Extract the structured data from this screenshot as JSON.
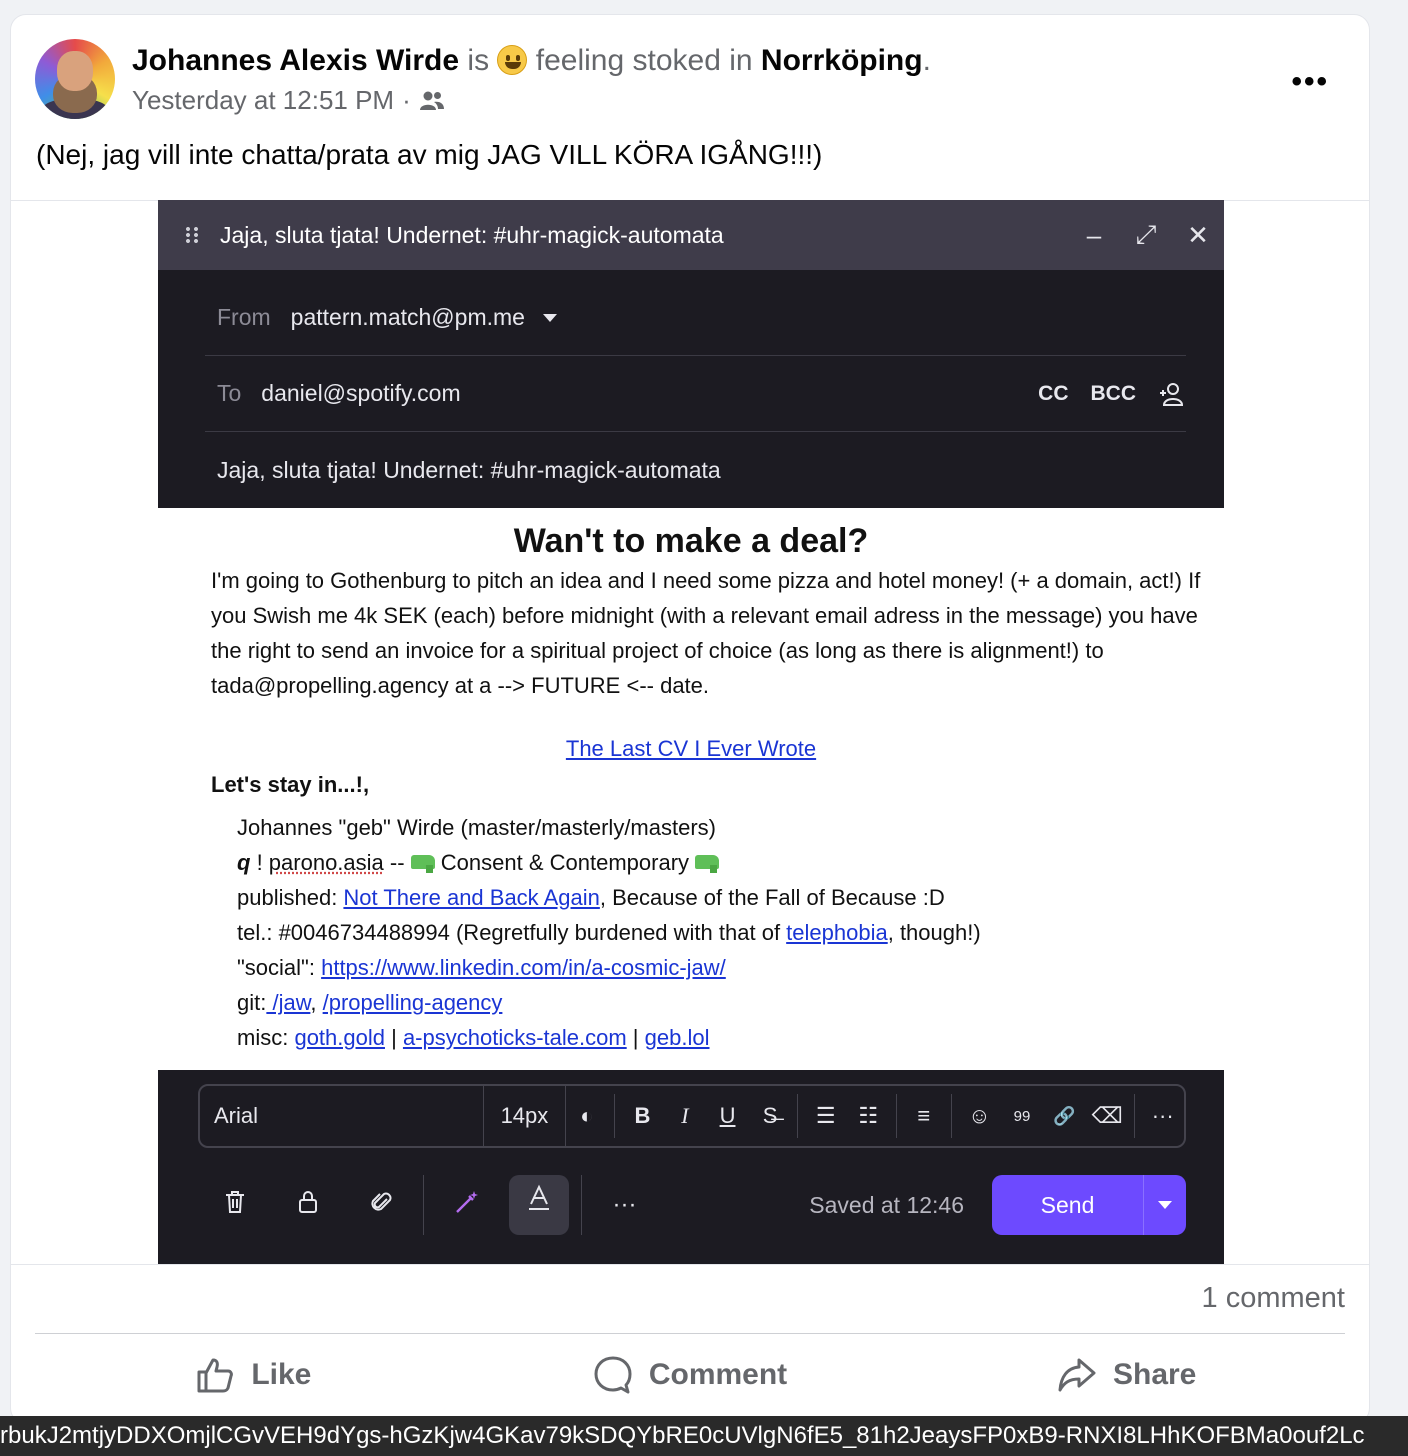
{
  "post": {
    "author": "Johannes Alexis Wirde",
    "is_word": "is",
    "feeling": "feeling stoked in",
    "place": "Norrköping",
    "period": ".",
    "timestamp": "Yesterday at 12:51 PM",
    "dot": "·",
    "audience_icon": "friends-icon",
    "more": "•••",
    "text": "(Nej, jag vill inte chatta/prata av mig JAG VILL KÖRA IGÅNG!!!)"
  },
  "shot": {
    "window_title": "Jaja, sluta tjata! Undernet: #uhr-magick-automata",
    "controls": [
      "–",
      "⤢",
      "✕"
    ],
    "from_label": "From",
    "from_value": "pattern.match@pm.me",
    "to_label": "To",
    "to_value": "daniel@spotify.com",
    "cc": "CC",
    "bcc": "BCC",
    "subject": "Jaja, sluta tjata! Undernet: #uhr-magick-automata",
    "body_title": "Wan't to make a deal?",
    "body_text": "I'm going to Gothenburg to pitch an idea and I need some pizza and hotel money! (+ a domain, act!) If you Swish me 4k SEK (each) before midnight (with a relevant email adress in the message) you have the right to send an invoice for a spiritual project of choice (as long as there is alignment!) to tada@propelling.agency at a --> FUTURE <-- date.",
    "cv_link": "The Last CV I Ever Wrote",
    "sign_head": "Let's stay in...!,",
    "sig_name": "Johannes \"geb\" Wirde (master/masterly/masters)",
    "sig_q": "q",
    "sig_q_rest": " ! ",
    "sig_parono": "parono.asia",
    "sig_dash": " -- ",
    "sig_consent": " Consent & Contemporary ",
    "sig_pub_label": "published: ",
    "sig_pub_link": "Not There and Back Again",
    "sig_pub_rest": ", Because of the Fall of Because :D",
    "sig_tel_label": "tel.: #0046734488994 (Regretfully burdened with that of ",
    "sig_tel_link": "telephobia",
    "sig_tel_rest": ", though!)",
    "sig_social_label": "\"social\": ",
    "sig_social_link": "https://www.linkedin.com/in/a-cosmic-jaw/",
    "sig_git_label": "git:",
    "sig_git_link1": " /jaw",
    "sig_git_sep": ", ",
    "sig_git_link2": "/propelling-agency",
    "sig_misc_label": "misc: ",
    "sig_misc_link1": "goth.gold",
    "sig_misc_sep": " | ",
    "sig_misc_link2": "a-psychoticks-tale.com",
    "sig_misc_link3": "geb.lol",
    "font": "Arial",
    "size": "14px",
    "fmt_icons": [
      "◐",
      "B",
      "I",
      "U",
      "S̶",
      "☰",
      "☷",
      "≡",
      "☺",
      "99",
      "🔗",
      "⌫",
      "···"
    ],
    "saved": "Saved at 12:46",
    "send": "Send",
    "more_actions": "···"
  },
  "footer": {
    "comment_count": "1 comment",
    "like": "Like",
    "comment": "Comment",
    "share": "Share"
  },
  "url_strip": "rbukJ2mtjyDDXOmjlCGvVEH9dYgs-hGzKjw4GKav79kSDQYbRE0cUVlgN6fE5_81h2JeaysFP0xB9-RNXI8LHhKOFBMa0ouf2Lc"
}
